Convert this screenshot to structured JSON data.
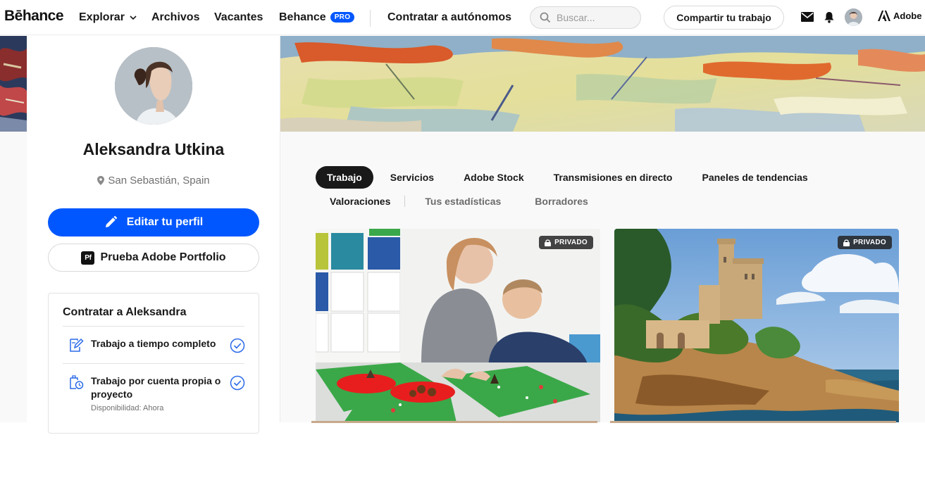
{
  "nav": {
    "logo": "Bēhance",
    "explore": "Explorar",
    "files": "Archivos",
    "jobs": "Vacantes",
    "behance": "Behance",
    "pro_badge": "PRO",
    "hire": "Contratar a autónomos",
    "search_placeholder": "Buscar...",
    "share": "Compartir tu trabajo",
    "adobe": "Adobe"
  },
  "profile": {
    "name": "Aleksandra Utkina",
    "location": "San Sebastián, Spain",
    "edit_button": "Editar tu perfil",
    "portfolio_icon": "Pf",
    "portfolio_button": "Prueba Adobe Portfolio"
  },
  "hire": {
    "title": "Contratar a Aleksandra",
    "options": [
      {
        "label": "Trabajo a tiempo completo",
        "sub": "",
        "icon": "document-edit-icon"
      },
      {
        "label_line1": "Trabajo por cuenta propia o",
        "label_line2": "proyecto",
        "sub": "Disponibilidad: Ahora",
        "icon": "freelance-clock-icon"
      }
    ]
  },
  "tabs": {
    "row1": [
      "Trabajo",
      "Servicios",
      "Adobe Stock",
      "Transmisiones en directo",
      "Paneles de tendencias"
    ],
    "row2": [
      "Valoraciones",
      "Tus estadísticas",
      "Borradores"
    ],
    "active": "Trabajo"
  },
  "projects": [
    {
      "badge": "PRIVADO"
    },
    {
      "badge": "PRIVADO"
    }
  ],
  "colors": {
    "accent": "#0057ff",
    "text": "#191919",
    "muted": "#707070",
    "active_tab": "#191919"
  }
}
